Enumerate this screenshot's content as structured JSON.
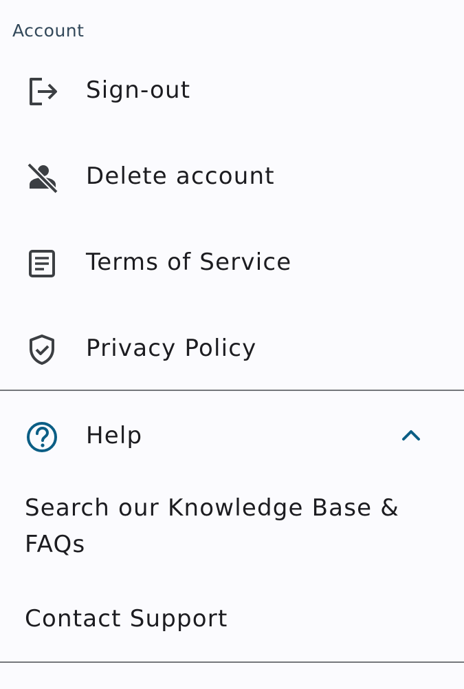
{
  "account": {
    "header": "Account",
    "items": [
      {
        "label": "Sign-out",
        "icon": "sign-out-icon"
      },
      {
        "label": "Delete account",
        "icon": "delete-account-icon"
      },
      {
        "label": "Terms of Service",
        "icon": "document-icon"
      },
      {
        "label": "Privacy Policy",
        "icon": "shield-check-icon"
      }
    ]
  },
  "help": {
    "label": "Help",
    "icon": "help-circle-icon",
    "expanded": true,
    "sub_items": [
      {
        "label": "Search our Knowledge Base & FAQs"
      },
      {
        "label": "Contact Support"
      }
    ]
  },
  "colors": {
    "accent": "#0b5e85",
    "icon": "#3c3f43",
    "divider": "#74777b",
    "background": "#fbfbfe"
  }
}
